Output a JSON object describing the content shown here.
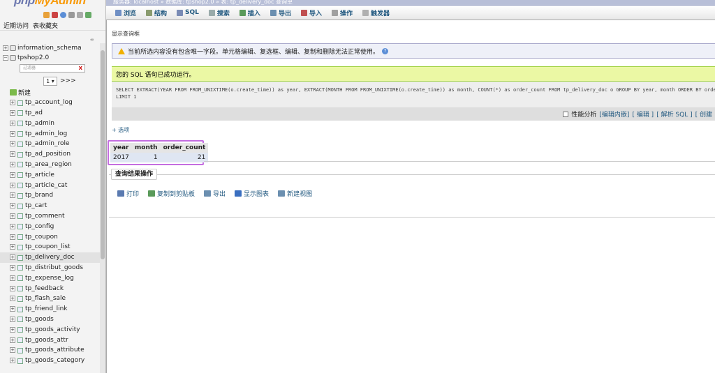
{
  "app": {
    "logo_a": "php",
    "logo_b": "MyAdmin",
    "breadcrumb": "服务器: localhost » 数据库: tpshop2.0 » 表: tp_delivery_doc  查询单"
  },
  "nav": {
    "links": [
      "近期访问",
      "表收藏夹"
    ],
    "databases": [
      "information_schema",
      "tpshop2.0"
    ],
    "filter_placeholder": "过滤器",
    "filter_clear": "X",
    "page_value": "1",
    "page_next": ">>>",
    "new_label": "新建",
    "tables": [
      "tp_account_log",
      "tp_ad",
      "tp_admin",
      "tp_admin_log",
      "tp_admin_role",
      "tp_ad_position",
      "tp_area_region",
      "tp_article",
      "tp_article_cat",
      "tp_brand",
      "tp_cart",
      "tp_comment",
      "tp_config",
      "tp_coupon",
      "tp_coupon_list",
      "tp_delivery_doc",
      "tp_distribut_goods",
      "tp_expense_log",
      "tp_feedback",
      "tp_flash_sale",
      "tp_friend_link",
      "tp_goods",
      "tp_goods_activity",
      "tp_goods_attr",
      "tp_goods_attribute",
      "tp_goods_category"
    ],
    "active_table": "tp_delivery_doc"
  },
  "tabs": [
    {
      "label": "浏览",
      "color": "#6f8fc4"
    },
    {
      "label": "结构",
      "color": "#8a9b6e"
    },
    {
      "label": "SQL",
      "color": "#7a8bb5"
    },
    {
      "label": "搜索",
      "color": "#9aa"
    },
    {
      "label": "插入",
      "color": "#5a9a5a"
    },
    {
      "label": "导出",
      "color": "#6b8fb0"
    },
    {
      "label": "导入",
      "color": "#c05050"
    },
    {
      "label": "操作",
      "color": "#a0a0a0"
    },
    {
      "label": "触发器",
      "color": "#b0b0b0"
    }
  ],
  "main": {
    "show_query": "显示查询框",
    "notice": "当前所选内容没有包含唯一字段。单元格编辑、复选框、编辑、复制和删除无法正常使用。",
    "success": "您的 SQL 语句已成功运行。",
    "sql_line1": "SELECT EXTRACT(YEAR FROM FROM_UNIXTIME(o.create_time)) as year, EXTRACT(MONTH FROM FROM_UNIXTIME(o.create_time)) as month, COUNT(*) as order_count FROM tp_delivery_doc o GROUP BY year, month ORDER BY orde",
    "sql_line2": "LIMIT 1",
    "profiling": "性能分析",
    "inline_edit": "[编辑内嵌]",
    "edit": "[ 编辑 ]",
    "explain": "[ 解析 SQL ]",
    "create": "[ 创建",
    "options": "+ 选项"
  },
  "results": {
    "columns": [
      "year",
      "month",
      "order_count"
    ],
    "rows": [
      [
        "2017",
        "1",
        "21"
      ]
    ]
  },
  "ops": {
    "title": "查询结果操作",
    "items": [
      {
        "label": "打印",
        "color": "#5a7ab0"
      },
      {
        "label": "复制到剪贴板",
        "color": "#5a9a5a"
      },
      {
        "label": "导出",
        "color": "#6b8fb0"
      },
      {
        "label": "显示图表",
        "color": "#3a6fc0"
      },
      {
        "label": "新建视图",
        "color": "#6b8fb0"
      }
    ]
  }
}
